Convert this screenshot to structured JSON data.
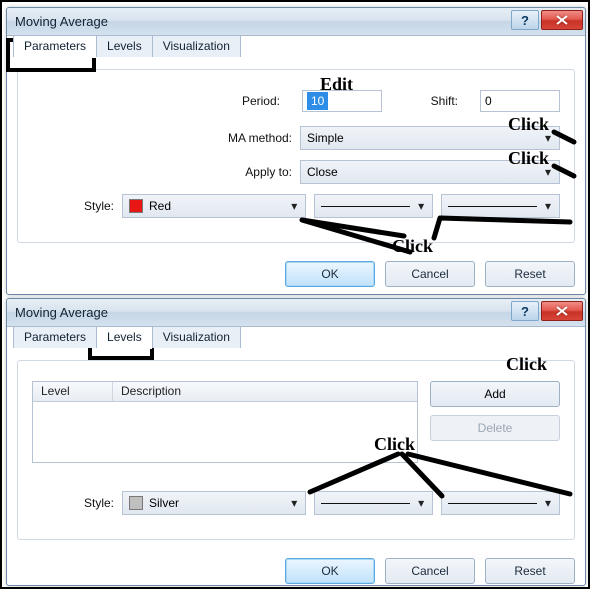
{
  "dialog1": {
    "title": "Moving Average",
    "tabs": [
      "Parameters",
      "Levels",
      "Visualization"
    ],
    "active_tab": "Parameters",
    "labels": {
      "period": "Period:",
      "shift": "Shift:",
      "method": "MA method:",
      "apply": "Apply to:",
      "style": "Style:"
    },
    "values": {
      "period": "10",
      "shift": "0",
      "method": "Simple",
      "apply": "Close",
      "style_color_name": "Red",
      "style_color_hex": "#e91616"
    },
    "buttons": {
      "ok": "OK",
      "cancel": "Cancel",
      "reset": "Reset"
    }
  },
  "dialog2": {
    "title": "Moving Average",
    "tabs": [
      "Parameters",
      "Levels",
      "Visualization"
    ],
    "active_tab": "Levels",
    "list": {
      "header_level": "Level",
      "header_desc": "Description",
      "rows": []
    },
    "sidebuttons": {
      "add": "Add",
      "delete": "Delete"
    },
    "style_label": "Style:",
    "style_color_name": "Silver",
    "style_color_hex": "#c0c0c0",
    "buttons": {
      "ok": "OK",
      "cancel": "Cancel",
      "reset": "Reset"
    }
  },
  "annotations": {
    "click": "Click",
    "edit": "Edit"
  }
}
